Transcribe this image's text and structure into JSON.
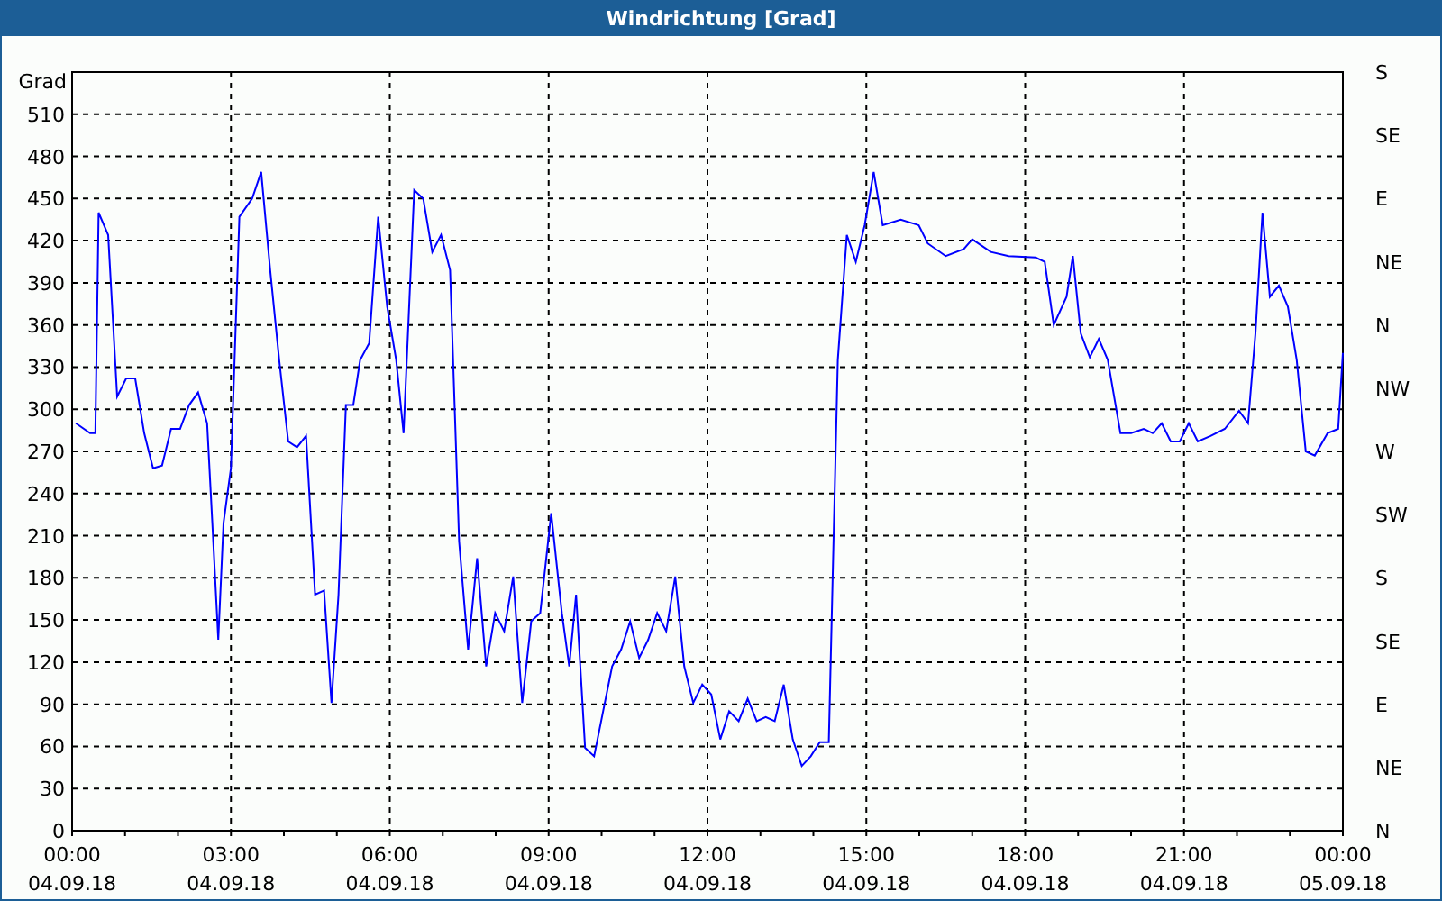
{
  "window": {
    "title": "Windrichtung [Grad]"
  },
  "chart": {
    "x_axis_dates": [
      "04.09.18",
      "04.09.18",
      "04.09.18",
      "04.09.18",
      "04.09.18",
      "04.09.18",
      "04.09.18",
      "04.09.18",
      "05.09.18"
    ],
    "right_axis_labels": [
      "S",
      "SE",
      "E",
      "NE",
      "N",
      "NW",
      "W",
      "SW",
      "S",
      "SE",
      "E",
      "NE",
      "N"
    ],
    "chart_data": {
      "type": "line",
      "ylabel": "Grad",
      "xlim": [
        0,
        24
      ],
      "ylim": [
        0,
        540
      ],
      "grid": true,
      "xticks": [
        {
          "value": 0,
          "label": "00:00"
        },
        {
          "value": 3,
          "label": "03:00"
        },
        {
          "value": 6,
          "label": "06:00"
        },
        {
          "value": 9,
          "label": "09:00"
        },
        {
          "value": 12,
          "label": "12:00"
        },
        {
          "value": 15,
          "label": "15:00"
        },
        {
          "value": 18,
          "label": "18:00"
        },
        {
          "value": 21,
          "label": "21:00"
        },
        {
          "value": 24,
          "label": "00:00"
        }
      ],
      "yticks": [
        0,
        30,
        60,
        90,
        120,
        150,
        180,
        210,
        240,
        270,
        300,
        330,
        360,
        390,
        420,
        450,
        480,
        510
      ],
      "x": [
        0.07,
        0.34,
        0.44,
        0.5,
        0.68,
        0.85,
        1.02,
        1.19,
        1.36,
        1.53,
        1.7,
        1.87,
        2.04,
        2.21,
        2.38,
        2.55,
        2.65,
        2.76,
        2.86,
        3.0,
        3.16,
        3.4,
        3.57,
        3.74,
        3.91,
        4.08,
        4.25,
        4.42,
        4.59,
        4.76,
        4.9,
        5.03,
        5.17,
        5.31,
        5.44,
        5.61,
        5.78,
        5.95,
        6.12,
        6.26,
        6.46,
        6.63,
        6.8,
        6.97,
        7.14,
        7.31,
        7.48,
        7.65,
        7.82,
        7.99,
        8.16,
        8.33,
        8.5,
        8.67,
        8.84,
        9.05,
        9.25,
        9.39,
        9.52,
        9.69,
        9.86,
        10.03,
        10.2,
        10.37,
        10.54,
        10.71,
        10.88,
        11.05,
        11.22,
        11.39,
        11.56,
        11.73,
        11.9,
        12.07,
        12.24,
        12.41,
        12.59,
        12.76,
        12.93,
        13.1,
        13.27,
        13.44,
        13.61,
        13.78,
        13.95,
        14.12,
        14.29,
        14.46,
        14.63,
        14.8,
        14.97,
        15.14,
        15.31,
        15.65,
        15.99,
        16.16,
        16.5,
        16.84,
        17.0,
        17.35,
        17.69,
        18.2,
        18.37,
        18.54,
        18.78,
        18.9,
        19.05,
        19.22,
        19.39,
        19.56,
        19.8,
        20.0,
        20.24,
        20.41,
        20.58,
        20.75,
        20.92,
        21.09,
        21.26,
        21.5,
        21.77,
        22.04,
        22.21,
        22.35,
        22.48,
        22.62,
        22.79,
        22.96,
        23.13,
        23.3,
        23.47,
        23.71,
        23.91,
        24.0
      ],
      "series": [
        {
          "color": "#0000ff",
          "values": [
            290,
            283,
            283,
            440,
            424,
            309,
            322,
            322,
            283,
            258,
            260,
            286,
            286,
            303,
            312,
            290,
            219,
            136,
            219,
            258,
            437,
            450,
            469,
            399,
            335,
            277,
            273,
            281,
            168,
            171,
            91,
            168,
            303,
            303,
            335,
            347,
            437,
            373,
            335,
            283,
            456,
            450,
            412,
            424,
            399,
            206,
            129,
            194,
            117,
            155,
            142,
            181,
            91,
            149,
            155,
            226,
            155,
            117,
            168,
            59,
            53,
            85,
            117,
            129,
            149,
            123,
            136,
            155,
            142,
            181,
            117,
            91,
            104,
            97,
            65,
            85,
            78,
            94,
            78,
            81,
            78,
            104,
            65,
            46,
            53,
            63,
            63,
            335,
            424,
            405,
            431,
            469,
            431,
            435,
            431,
            418,
            409,
            414,
            421,
            412,
            409,
            408,
            405,
            360,
            380,
            409,
            354,
            337,
            350,
            335,
            283,
            283,
            286,
            283,
            290,
            277,
            277,
            290,
            277,
            281,
            286,
            299,
            290,
            354,
            440,
            380,
            388,
            373,
            335,
            270,
            267,
            283,
            286,
            340
          ]
        }
      ]
    }
  }
}
